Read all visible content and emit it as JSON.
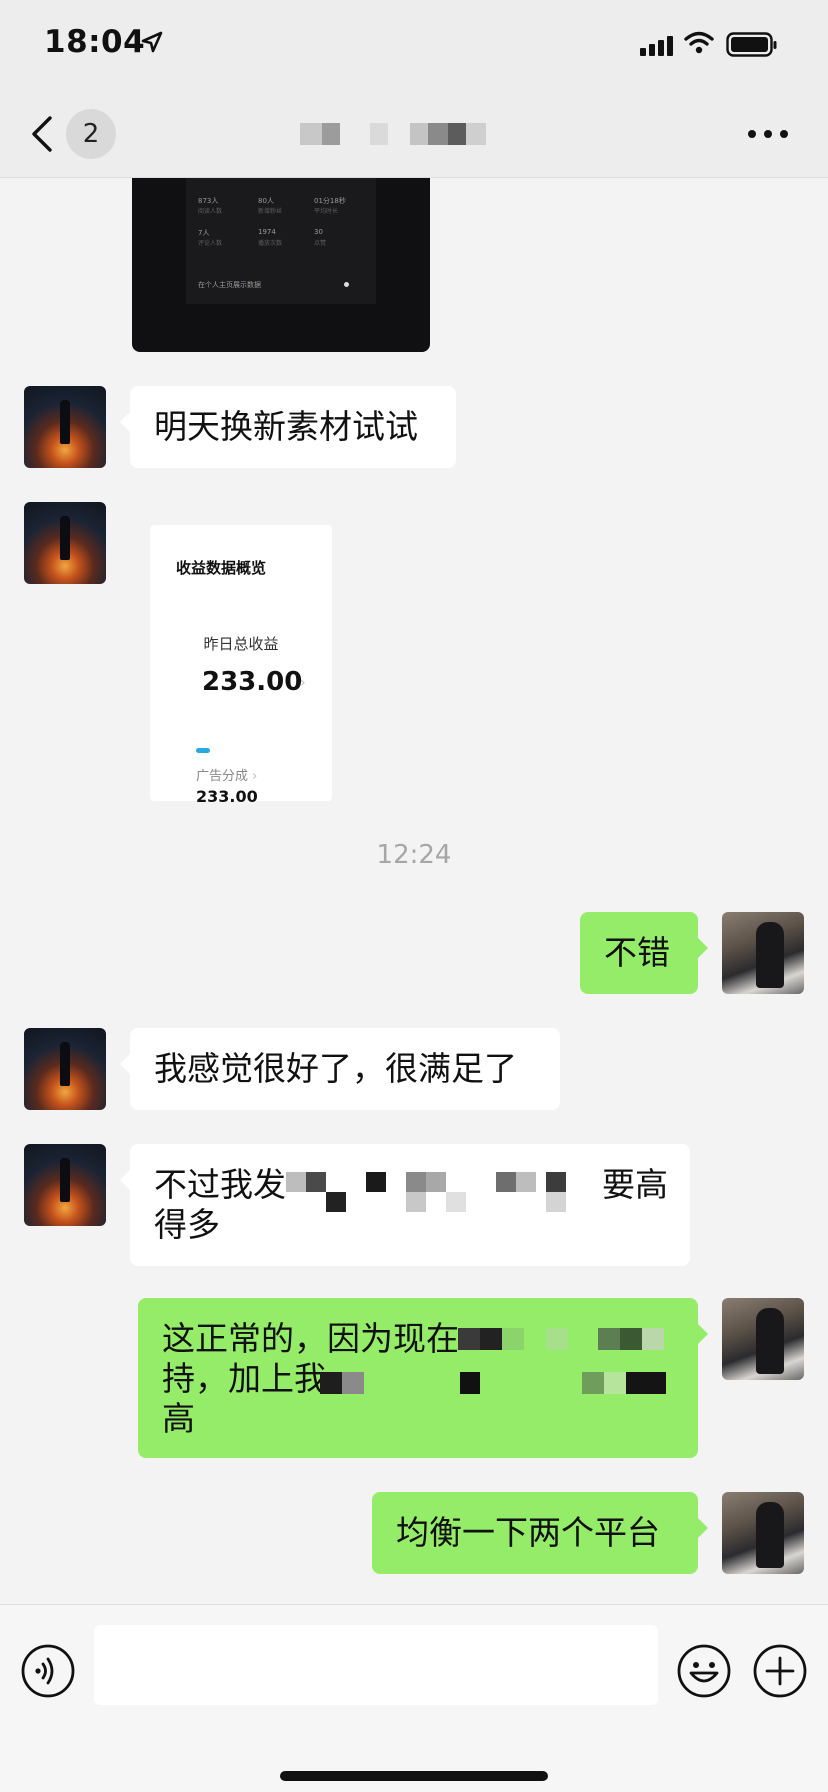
{
  "status_bar": {
    "time": "18:04"
  },
  "nav": {
    "unread_count": "2"
  },
  "dark_image": {
    "stats": [
      {
        "value": "873人",
        "caption": "阅读人数"
      },
      {
        "value": "80人",
        "caption": "新增粉丝"
      },
      {
        "value": "01分18秒",
        "caption": "平均时长"
      },
      {
        "value": "7人",
        "caption": "评论人数"
      },
      {
        "value": "1974",
        "caption": "播放次数"
      },
      {
        "value": "30",
        "caption": "点赞"
      }
    ],
    "footer": "在个人主页展示数据"
  },
  "earnings_image": {
    "title": "收益数据概览",
    "subtitle": "昨日总收益",
    "total": "233.00",
    "label": "广告分成",
    "label_arrow": "›",
    "amount": "233.00",
    "total_arrow": "›"
  },
  "messages": [
    {
      "side": "in",
      "text": "明天换新素材试试"
    },
    {
      "side": "out",
      "text": "不错"
    },
    {
      "side": "in",
      "text": "我感觉很好了，很满足了"
    },
    {
      "side": "in",
      "line1_start": "不过我发",
      "line1_end": "要高",
      "line2": "得多"
    },
    {
      "side": "out",
      "line1": "这正常的，因为现在",
      "line2": "持，加上我",
      "line3": "高"
    },
    {
      "side": "out",
      "text": "均衡一下两个平台"
    }
  ],
  "timestamp": "12:24",
  "input": {
    "value": ""
  }
}
